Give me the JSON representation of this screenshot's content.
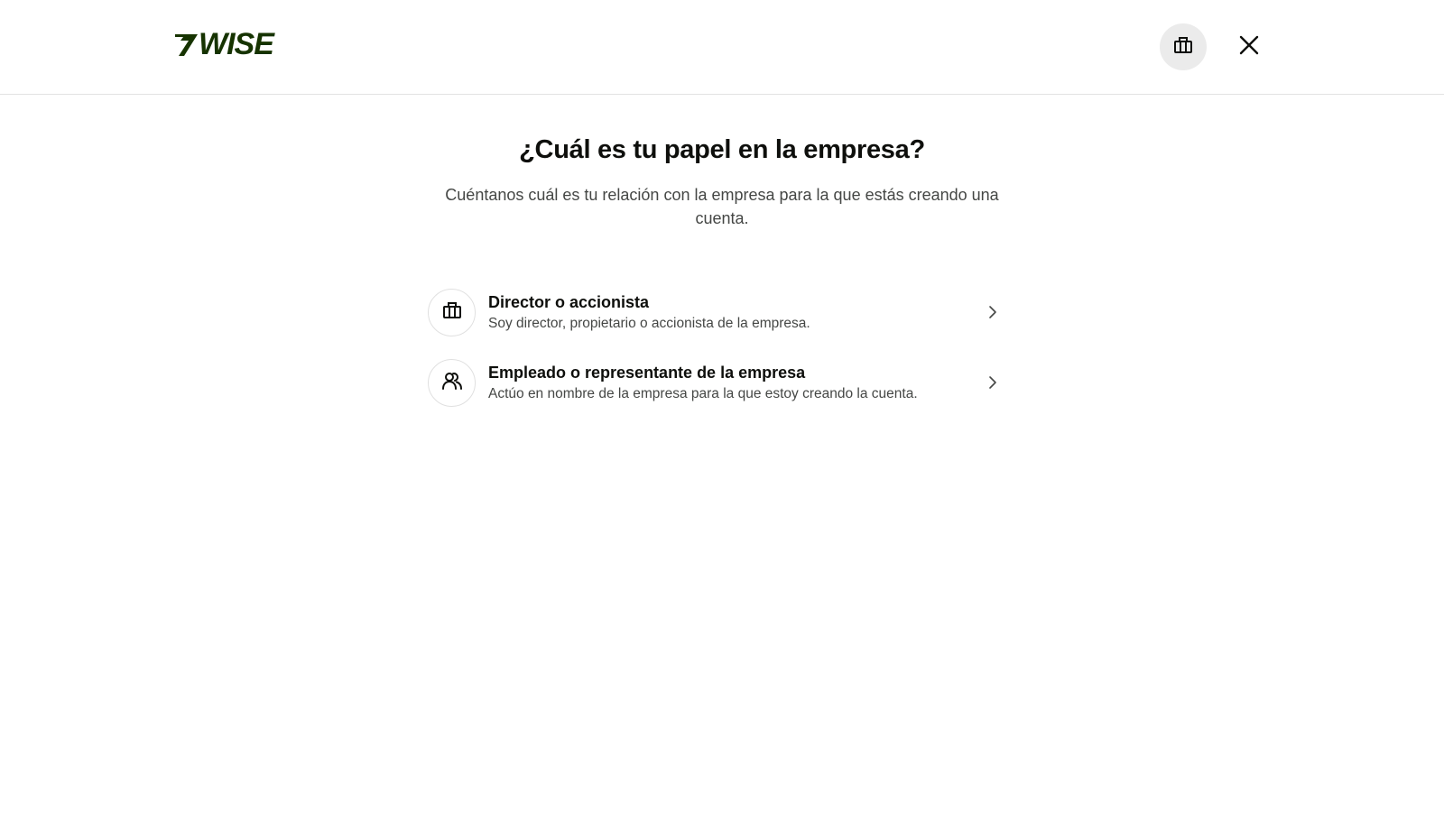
{
  "header": {
    "logo_text": "WISE",
    "brand_color": "#163300",
    "account_button_icon": "briefcase-icon",
    "close_button_icon": "close-icon"
  },
  "main": {
    "title": "¿Cuál es tu papel en la empresa?",
    "subtitle": "Cuéntanos cuál es tu relación con la empresa para la que estás creando una cuenta."
  },
  "options": [
    {
      "icon": "briefcase-icon",
      "title": "Director o accionista",
      "description": "Soy director, propietario o accionista de la empresa."
    },
    {
      "icon": "people-icon",
      "title": "Empleado o representante de la empresa",
      "description": "Actúo en nombre de la empresa para la que estoy creando la cuenta."
    }
  ]
}
